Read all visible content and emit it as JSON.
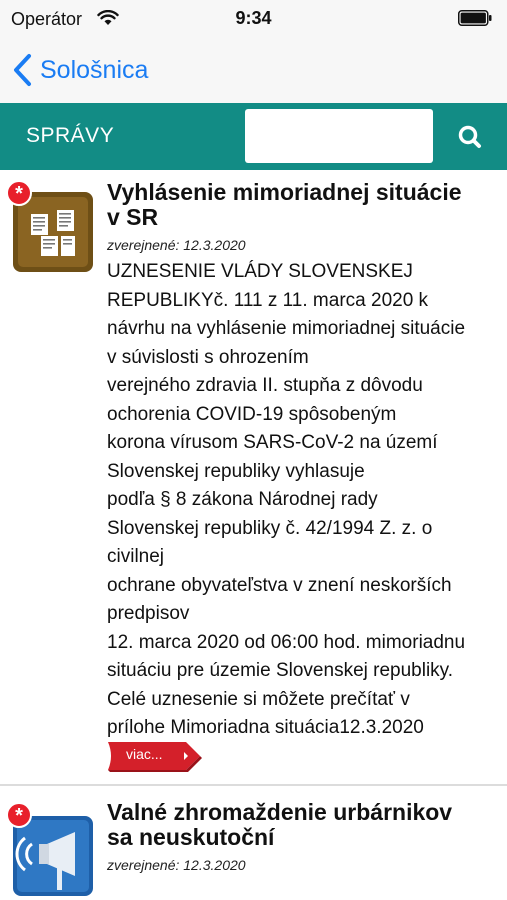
{
  "status_bar": {
    "carrier": "Operátor",
    "time": "9:34"
  },
  "nav": {
    "back_label": "Sološnica"
  },
  "section": {
    "title": "SPRÁVY",
    "search_placeholder": ""
  },
  "articles": [
    {
      "title_lines": [
        "Vyhlásenie mimoriadnej situácie",
        "v SR"
      ],
      "published": "zverejnené: 12.3.2020",
      "body_lines": [
        "UZNESENIE VLÁDY SLOVENSKEJ",
        "REPUBLIKYč. 111 z 11. marca 2020 k",
        "návrhu na vyhlásenie mimoriadnej situácie",
        "v súvislosti s ohrozením",
        "verejného zdravia II. stupňa z dôvodu",
        "ochorenia COVID-19 spôsobeným",
        "korona vírusom SARS-CoV-2 na území",
        "Slovenskej republiky vyhlasuje",
        "podľa § 8 zákona Národnej rady",
        "Slovenskej republiky č. 42/1994 Z. z. o",
        "civilnej",
        "ochrane obyvateľstva v znení neskorších",
        "predpisov",
        "12. marca 2020 od 06:00 hod. mimoriadnu",
        "situáciu pre územie Slovenskej republiky.",
        "Celé uznesenie si môžete prečítať v",
        "prílohe  Mimoriadna situácia12.3.2020"
      ],
      "more_label": "viac...",
      "badge": "*",
      "icon": "document-board-icon"
    },
    {
      "title_lines": [
        "Valné zhromaždenie urbárnikov",
        "sa neuskutoční"
      ],
      "published": "zverejnené: 12.3.2020",
      "badge": "*",
      "icon": "megaphone-icon"
    }
  ],
  "colors": {
    "accent_teal": "#128c85",
    "ios_blue": "#1a7cf3",
    "badge_red": "#e8202b",
    "more_red": "#d4202a"
  }
}
